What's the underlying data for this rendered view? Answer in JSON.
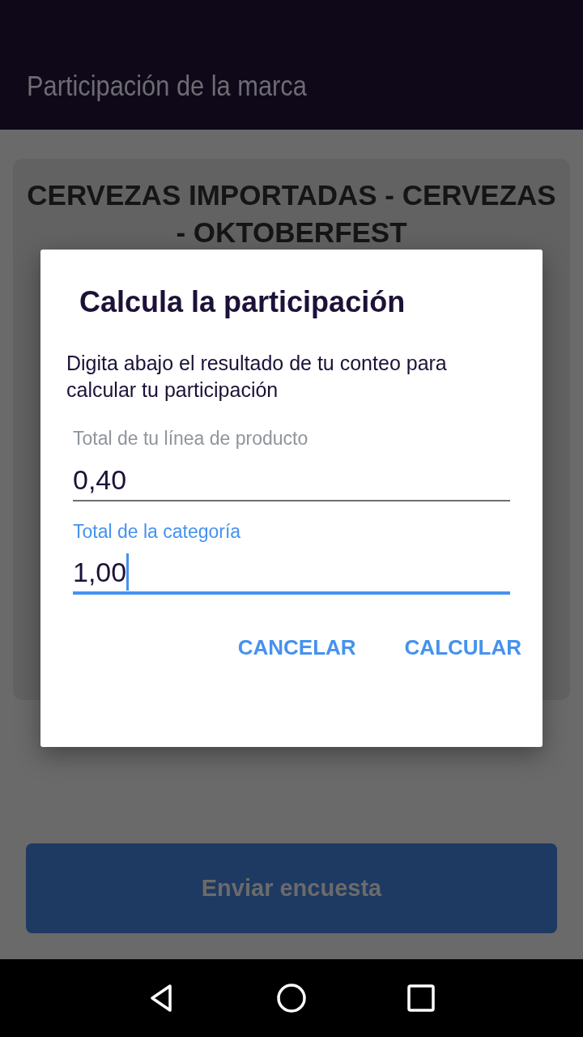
{
  "app_bar": {
    "title": "Participación de la marca"
  },
  "card": {
    "heading": "CERVEZAS IMPORTADAS - CERVEZAS - OKTOBERFEST"
  },
  "submit_button": {
    "label": "Enviar encuesta",
    "disabled": true
  },
  "dialog": {
    "title": "Calcula la participación",
    "message": "Digita abajo el resultado de tu conteo para calcular tu participación",
    "fields": [
      {
        "label": "Total de tu línea de producto",
        "value": "0,40",
        "focused": false
      },
      {
        "label": "Total de la categoría",
        "value": "1,00",
        "focused": true
      }
    ],
    "actions": [
      "CANCELAR",
      "CALCULAR"
    ]
  }
}
